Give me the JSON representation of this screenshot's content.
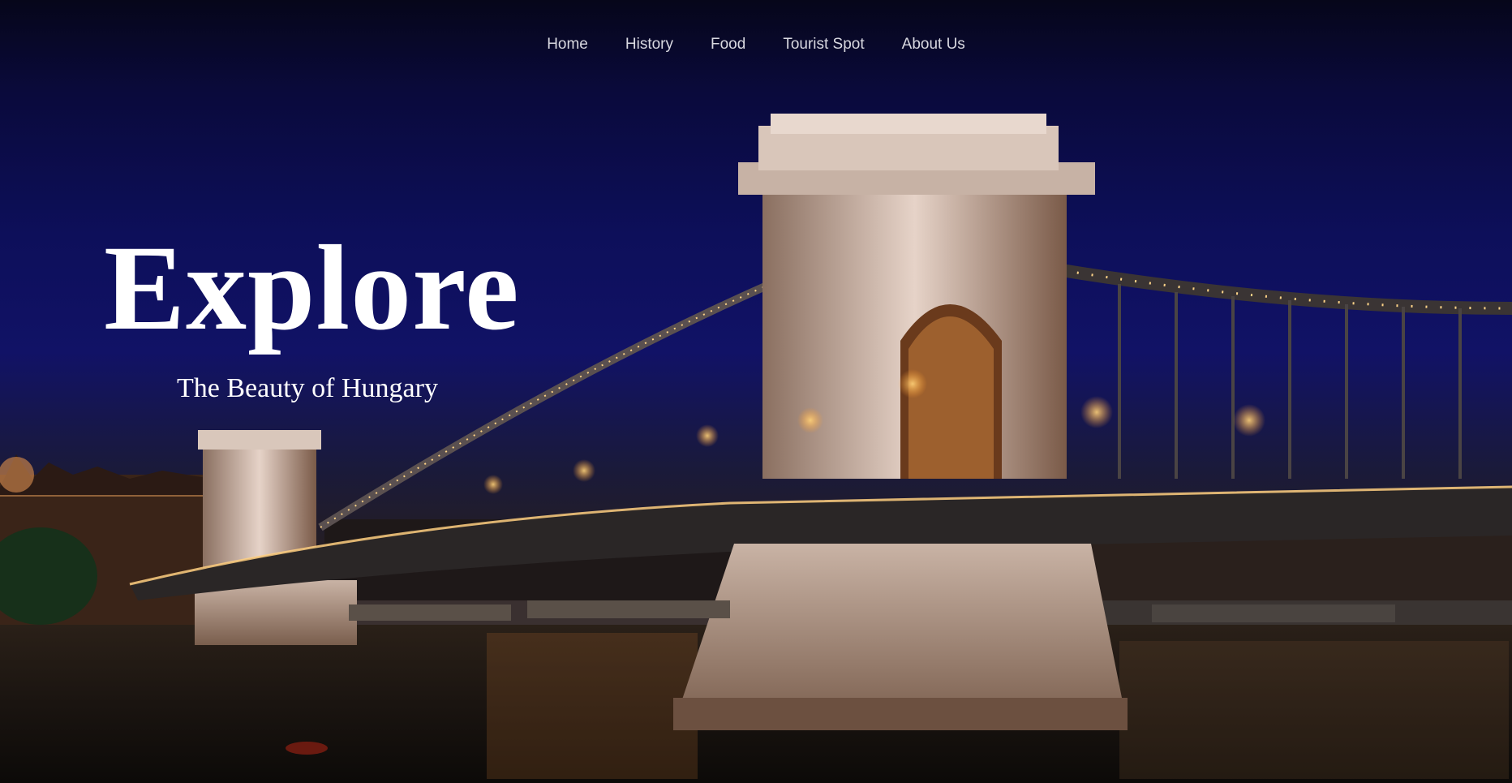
{
  "nav": {
    "items": [
      {
        "label": "Home"
      },
      {
        "label": "History"
      },
      {
        "label": "Food"
      },
      {
        "label": "Tourist Spot"
      },
      {
        "label": "About Us"
      }
    ]
  },
  "hero": {
    "title": "Explore",
    "subtitle": "The Beauty of Hungary"
  },
  "colors": {
    "sky": "#0d0f5a",
    "text": "#ffffff",
    "nav_text": "#d8d8e0",
    "lights": "#ffb84a"
  },
  "image": {
    "subject": "chain-bridge-night"
  }
}
